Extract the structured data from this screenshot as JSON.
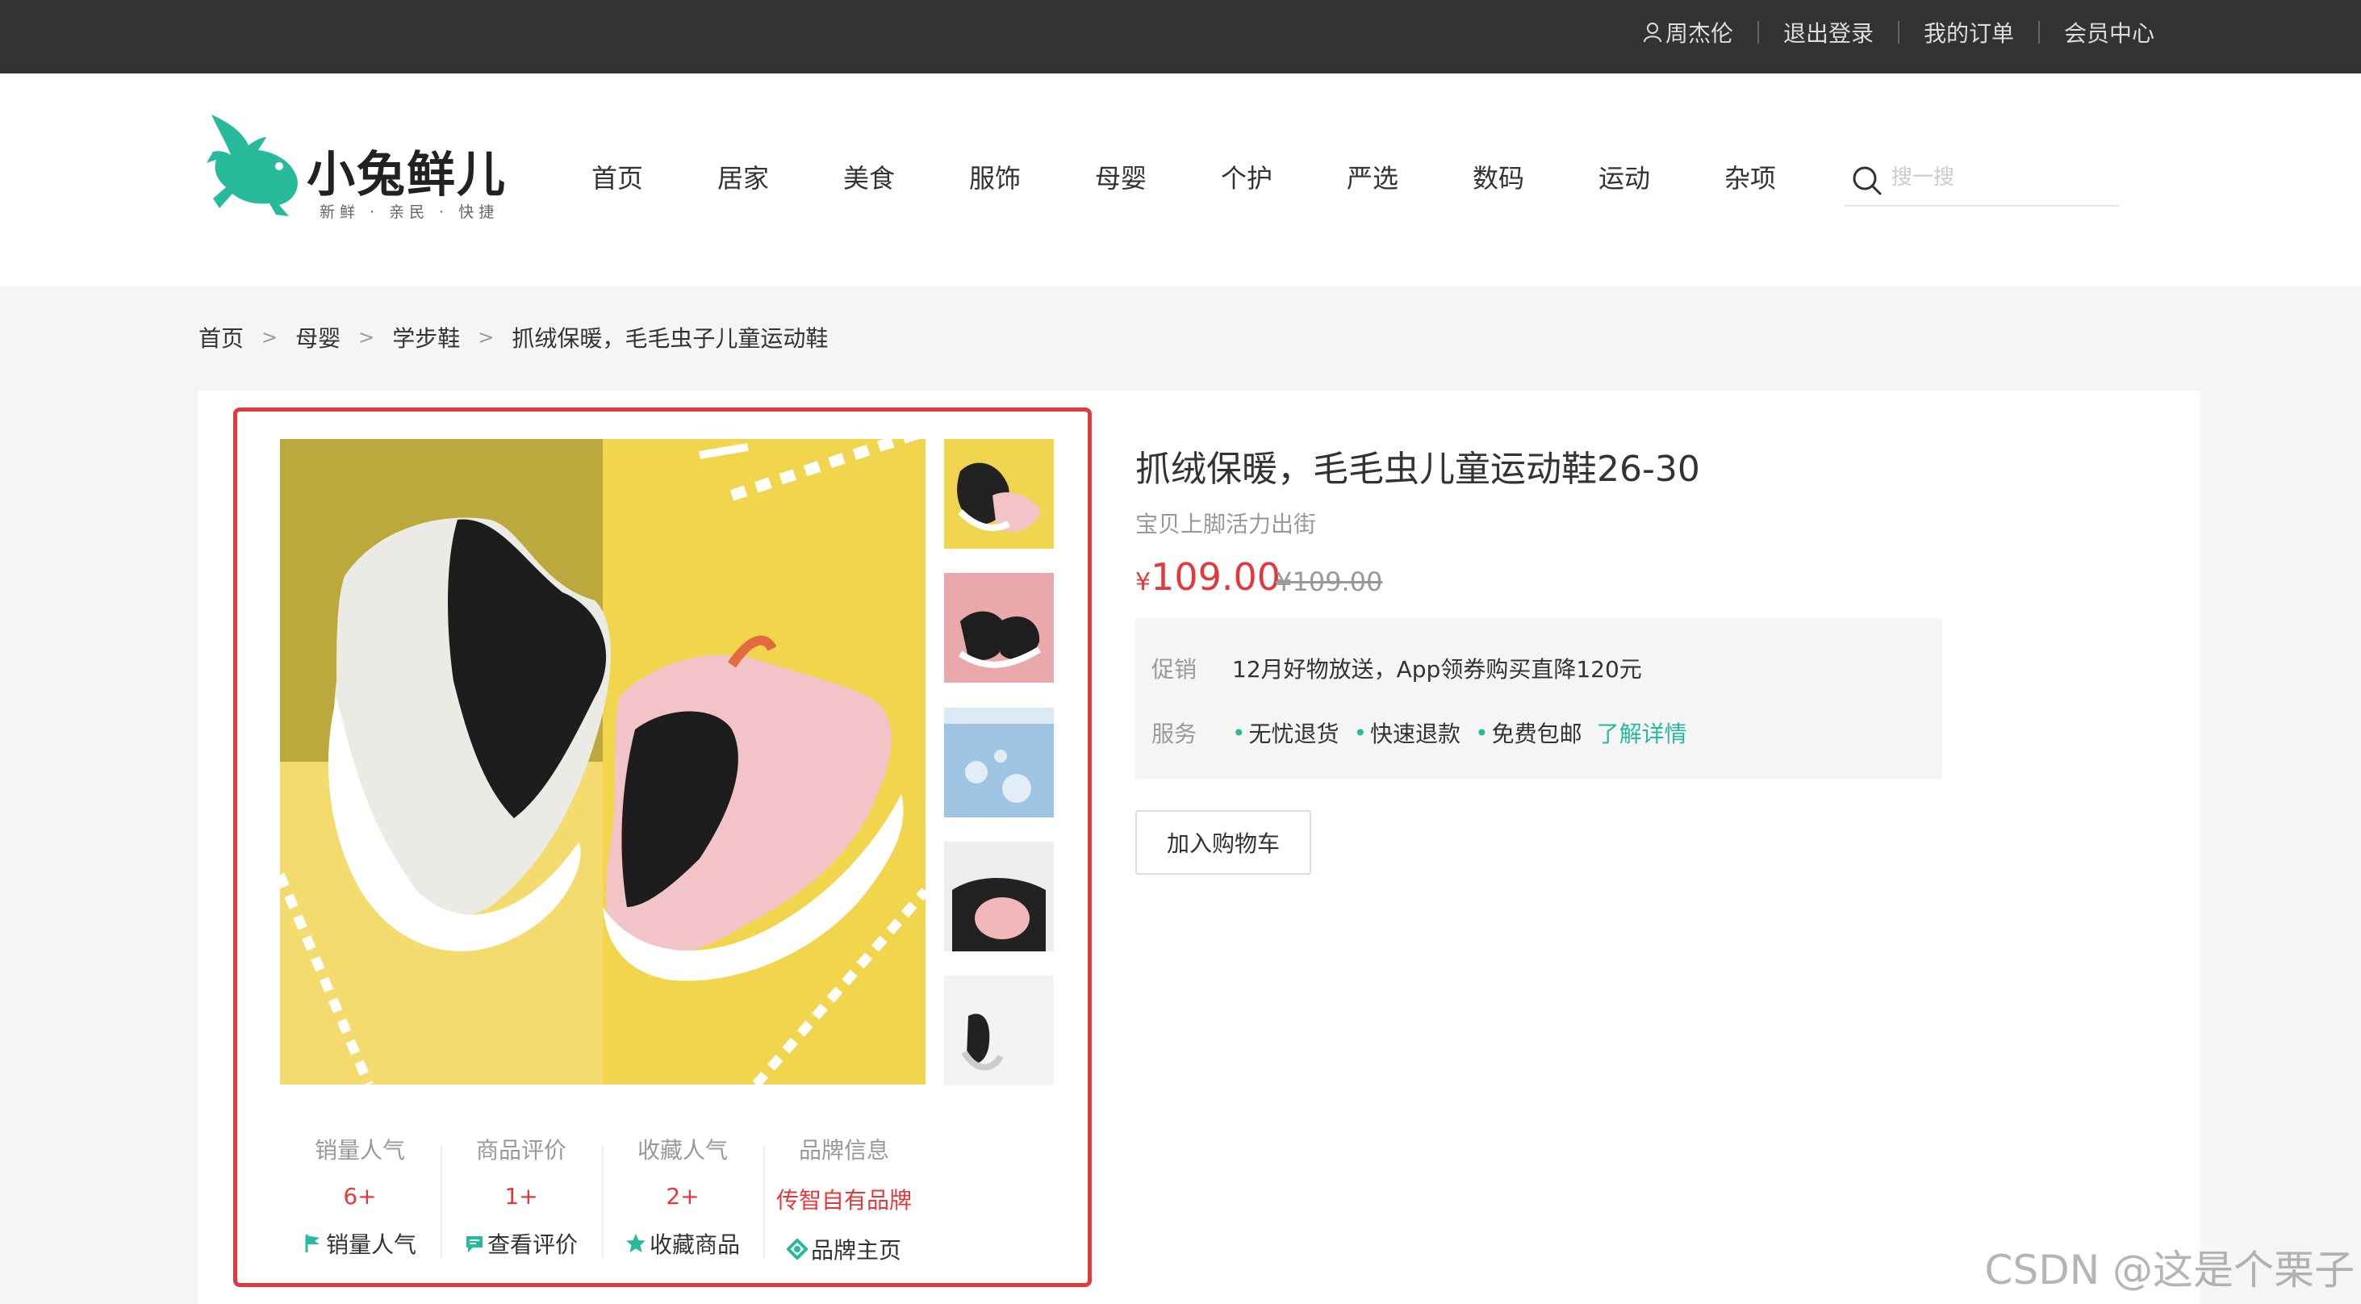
{
  "topbar": {
    "user_name": "周杰伦",
    "logout": "退出登录",
    "orders": "我的订单",
    "member": "会员中心"
  },
  "logo": {
    "brand": "小兔鲜儿",
    "tagline": "新鲜 · 亲民 · 快捷"
  },
  "nav": [
    "首页",
    "居家",
    "美食",
    "服饰",
    "母婴",
    "个护",
    "严选",
    "数码",
    "运动",
    "杂项"
  ],
  "search": {
    "placeholder": "搜一搜"
  },
  "breadcrumb": [
    "首页",
    "母婴",
    "学步鞋",
    "抓绒保暖，毛毛虫子儿童运动鞋"
  ],
  "product": {
    "title": "抓绒保暖，毛毛虫儿童运动鞋26-30",
    "desc": "宝贝上脚活力出街",
    "currency": "¥",
    "price": "109.00",
    "old_price": "¥109.00",
    "promo_label": "促销",
    "promo_text": "12月好物放送，App领券购买直降120元",
    "service_label": "服务",
    "services": [
      "无忧退货",
      "快速退款",
      "免费包邮"
    ],
    "service_more": "了解详情",
    "cart_button": "加入购物车"
  },
  "stats": [
    {
      "label": "销量人气",
      "value": "6+",
      "link": "销量人气",
      "icon": "flag-icon"
    },
    {
      "label": "商品评价",
      "value": "1+",
      "link": "查看评价",
      "icon": "comment-icon"
    },
    {
      "label": "收藏人气",
      "value": "2+",
      "link": "收藏商品",
      "icon": "star-icon"
    },
    {
      "label": "品牌信息",
      "value": "传智自有品牌",
      "link": "品牌主页",
      "icon": "brand-icon"
    }
  ],
  "watermark": "CSDN @这是个栗子",
  "colors": {
    "accent": "#27ba9b",
    "price": "#e4393c",
    "highlight_border": "#e4393c"
  }
}
